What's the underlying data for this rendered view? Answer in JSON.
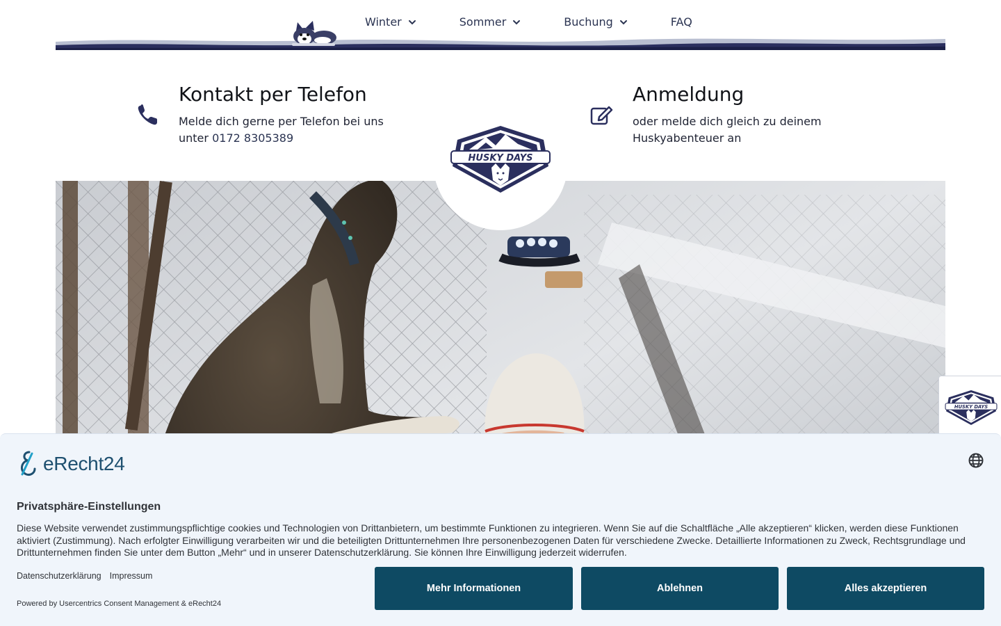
{
  "nav": {
    "items": [
      {
        "label": "Winter"
      },
      {
        "label": "Sommer"
      },
      {
        "label": "Buchung"
      }
    ],
    "faq_label": "FAQ"
  },
  "contact_phone": {
    "title": "Kontakt per Telefon",
    "text_before": "Melde dich gerne per Telefon bei uns unter",
    "phone": "0172 8305389"
  },
  "contact_signup": {
    "title": "Anmeldung",
    "text": "oder melde dich gleich zu deinem Huskyabenteuer an"
  },
  "brand": {
    "badge_text": "HUSKY DAYS",
    "navy": "#2b2f5e",
    "button_color": "#0e4a63"
  },
  "consent": {
    "logo_text": "eRecht24",
    "title": "Privatsphäre-Einstellungen",
    "text": "Diese Website verwendet zustimmungspflichtige cookies und Technologien von Drittanbietern, um bestimmte Funktionen zu integrieren. Wenn Sie auf die Schaltfläche „Alle akzeptieren“ klicken, werden diese Funktionen aktiviert (Zustimmung). Nach erfolgter Einwilligung verarbeiten wir und die beteiligten Drittunternehmen Ihre personenbezogenen Daten für verschiedene Zwecke. Detaillierte Informationen zu Zweck, Rechtsgrundlage und Drittunternehmen finden Sie unter dem Button „Mehr“ und in unserer Datenschutzerklärung. Sie können Ihre Einwilligung jederzeit widerrufen.",
    "link_privacy": "Datenschutzerklärung",
    "link_imprint": "Impressum",
    "powered_by": "Powered by Usercentrics Consent Management & eRecht24",
    "btn_more": "Mehr Informationen",
    "btn_deny": "Ablehnen",
    "btn_accept": "Alles akzeptieren"
  }
}
